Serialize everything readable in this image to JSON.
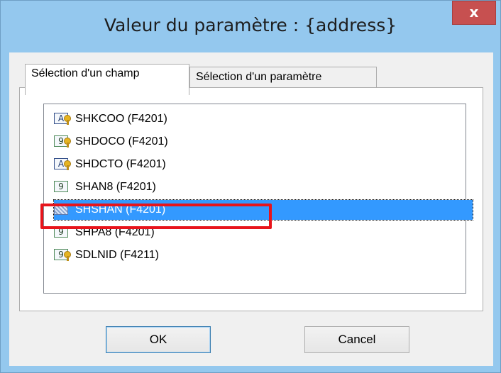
{
  "window": {
    "title": "Valeur du paramètre : {address}",
    "close_label": "x"
  },
  "tabs": [
    {
      "label": "Sélection d'un champ",
      "active": true
    },
    {
      "label": "Sélection d'un paramètre",
      "active": false
    }
  ],
  "fields": [
    {
      "label": "SHKCOO (F4201)",
      "icon": "alpha-key-icon",
      "icon_text": "A"
    },
    {
      "label": "SHDOCO (F4201)",
      "icon": "numeric-key-icon",
      "icon_text": "9"
    },
    {
      "label": "SHDCTO (F4201)",
      "icon": "alpha-key-icon",
      "icon_text": "A"
    },
    {
      "label": "SHAN8 (F4201)",
      "icon": "numeric-icon",
      "icon_text": "9"
    },
    {
      "label": "SHSHAN (F4201)",
      "icon": "selected-field-icon",
      "icon_text": "",
      "selected": true
    },
    {
      "label": "SHPA8 (F4201)",
      "icon": "numeric-icon",
      "icon_text": "9"
    },
    {
      "label": "SDLNID (F4211)",
      "icon": "numeric-key-icon",
      "icon_text": "9"
    }
  ],
  "buttons": {
    "ok_label": "OK",
    "cancel_label": "Cancel"
  },
  "colors": {
    "frame": "#94c8ee",
    "close": "#c75050",
    "selection": "#3399ff",
    "annotation": "#e8141b"
  }
}
